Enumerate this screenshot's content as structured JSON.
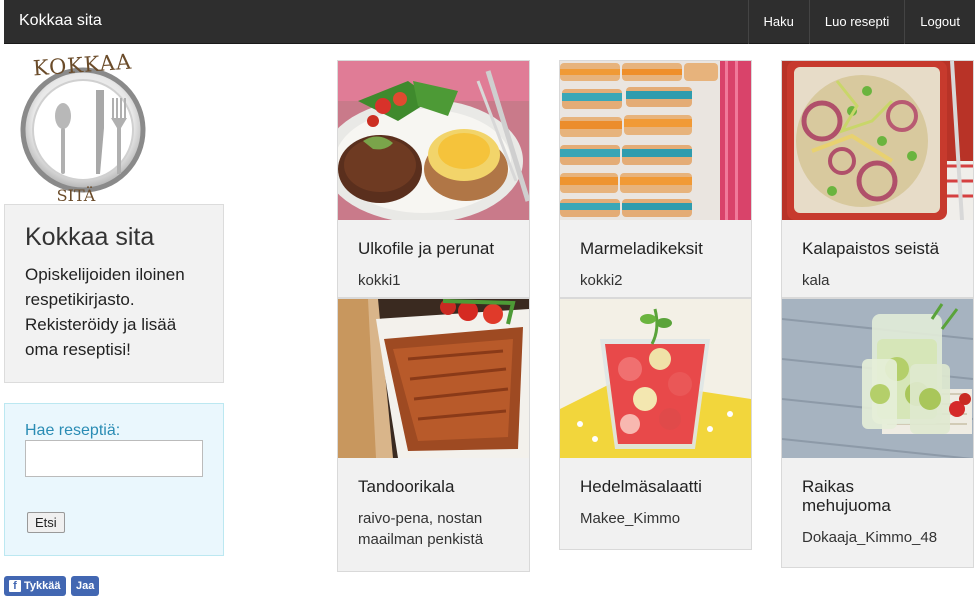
{
  "navbar": {
    "brand": "Kokkaa sita",
    "links": [
      "Haku",
      "Luo resepti",
      "Logout"
    ]
  },
  "logo": {
    "top_text": "KOKKAA",
    "bottom_text": "SITÄ"
  },
  "intro": {
    "heading": "Kokkaa sita",
    "text": "Opiskelijoiden iloinen respetikirjasto. Rekisteröidy ja lisää oma reseptisi!"
  },
  "search": {
    "label": "Hae reseptiä:",
    "value": "",
    "button": "Etsi"
  },
  "social": {
    "like": "Tykkää",
    "share": "Jaa",
    "icon": "facebook-icon"
  },
  "recipes": [
    {
      "title": "Ulkofile ja perunat",
      "author": "kokki1",
      "image": "steak-potato-photo"
    },
    {
      "title": "Marmeladikeksit",
      "author": "kokki2",
      "image": "cookies-photo"
    },
    {
      "title": "Kalapaistos seistä",
      "author": "kala",
      "image": "fish-salad-photo"
    },
    {
      "title": "Tandoorikala",
      "author": "raivo-pena, nostan maailman penkistä",
      "image": "tandoori-fish-photo"
    },
    {
      "title": "Hedelmäsalaatti",
      "author": "Makee_Kimmo",
      "image": "fruit-salad-photo"
    },
    {
      "title": "Raikas mehujuoma",
      "author": "Dokaaja_Kimmo_48",
      "image": "drink-photo"
    }
  ]
}
